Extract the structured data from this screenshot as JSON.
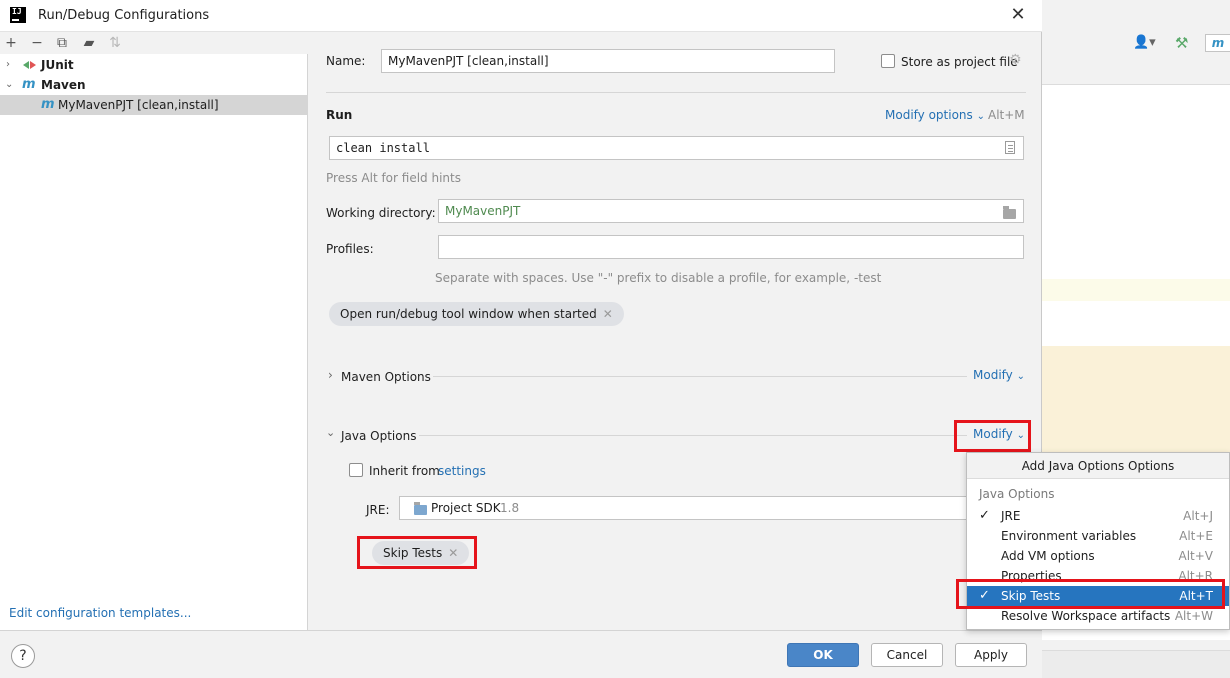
{
  "dialog": {
    "title": "Run/Debug Configurations",
    "close_glyph": "✕"
  },
  "left": {
    "toolbar_icons": [
      "add-icon",
      "remove-icon",
      "copy-icon",
      "folder-add-icon",
      "sort-icon"
    ],
    "tree": [
      {
        "label": "JUnit",
        "icon": "junit-icon",
        "expanded": false
      },
      {
        "label": "Maven",
        "icon": "maven-icon",
        "expanded": true
      },
      {
        "label": "MyMavenPJT [clean,install]",
        "icon": "maven-icon",
        "selected": true
      }
    ],
    "edit_templates": "Edit configuration templates..."
  },
  "form": {
    "name_label": "Name:",
    "name_value": "MyMavenPJT [clean,install]",
    "store_label": "Store as project file",
    "run_heading": "Run",
    "modify_options": "Modify options",
    "modify_options_shortcut": "Alt+M",
    "command_value": "clean install",
    "field_hint": "Press Alt for field hints",
    "workdir_label": "Working directory:",
    "workdir_value": "MyMavenPJT",
    "profiles_label": "Profiles:",
    "profiles_value": "",
    "profiles_hint": "Separate with spaces. Use \"-\" prefix to disable a profile, for example, -test",
    "open_tool_window_chip": "Open run/debug tool window when started",
    "maven_options": "Maven Options",
    "maven_modify": "Modify",
    "java_options": "Java Options",
    "java_modify": "Modify",
    "inherit_label": "Inherit from",
    "inherit_link": "settings",
    "jre_label": "JRE:",
    "jre_value": "Project SDK",
    "jre_version": "1.8",
    "skip_tests_chip": "Skip Tests"
  },
  "popup": {
    "header": "Add Java Options Options",
    "group": "Java Options",
    "items": [
      {
        "label": "JRE",
        "key": "Alt+J",
        "checked": true,
        "active": false
      },
      {
        "label": "Environment variables",
        "key": "Alt+E",
        "checked": false,
        "active": false
      },
      {
        "label": "Add VM options",
        "key": "Alt+V",
        "checked": false,
        "active": false
      },
      {
        "label": "Properties",
        "key": "Alt+R",
        "checked": false,
        "active": false
      },
      {
        "label": "Skip Tests",
        "key": "Alt+T",
        "checked": true,
        "active": true
      },
      {
        "label": "Resolve Workspace artifacts",
        "key": "Alt+W",
        "checked": false,
        "active": false
      }
    ]
  },
  "buttons": {
    "help": "?",
    "ok": "OK",
    "cancel": "Cancel",
    "apply": "Apply"
  },
  "colors": {
    "accent": "#2675bf",
    "link": "#2470b3",
    "highlight_box": "#e5141b",
    "primary_button": "#4a86c8"
  }
}
